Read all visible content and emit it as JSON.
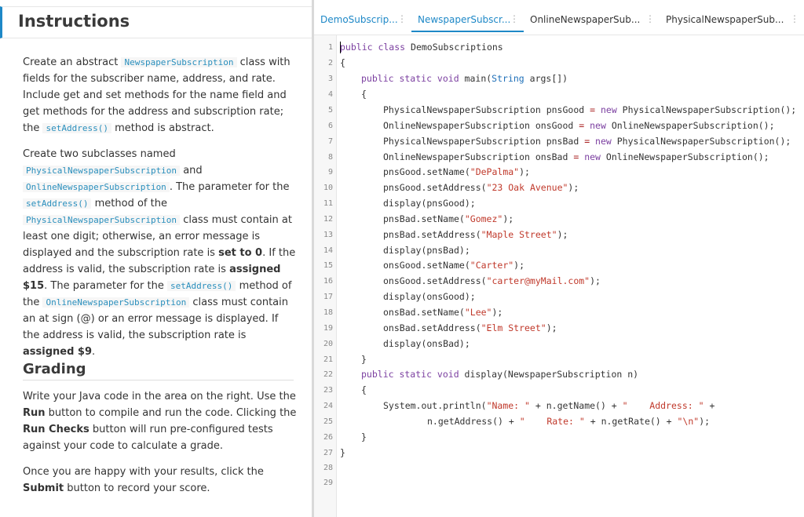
{
  "instructions": {
    "title": "Instructions",
    "p1": {
      "t1": "Create an abstract ",
      "c1": "NewspaperSubscription",
      "t2": " class with fields for the subscriber name, address, and rate. Include get and set methods for the name field and get methods for the address and subscription rate; the ",
      "c2": "setAddress()",
      "t3": " method is abstract."
    },
    "p2": {
      "t1": "Create two subclasses named ",
      "c1": "PhysicalNewspaperSubscription",
      "t2": " and ",
      "c2": "OnlineNewspaperSubscription",
      "t3": ". The parameter for the ",
      "c3": "setAddress()",
      "t4": " method of the ",
      "c4": "PhysicalNewspaperSubscription",
      "t5": " class must contain at least one digit; otherwise, an error message is displayed and the subscription rate is ",
      "b1": "set to 0",
      "t6": ". If the address is valid, the subscription rate is ",
      "b2": "assigned $15",
      "t7": ". The parameter for the ",
      "c5": "setAddress()",
      "t8": " method of the ",
      "c6": "OnlineNewspaperSubscription",
      "t9": " class must contain an at sign (@) or an error message is displayed. If the address is valid, the subscription rate is ",
      "b3": "assigned $9",
      "t10": "."
    }
  },
  "grading": {
    "title": "Grading",
    "p1": {
      "t1": "Write your Java code in the area on the right. Use the ",
      "b1": "Run",
      "t2": " button to compile and run the code. Clicking the ",
      "b2": "Run Checks",
      "t3": " button will run pre-configured tests against your code to calculate a grade."
    },
    "p2": {
      "t1": "Once you are happy with your results, click the ",
      "b1": "Submit",
      "t2": " button to record your score."
    }
  },
  "tabs": [
    {
      "label": "DemoSubscrip..."
    },
    {
      "label": "NewspaperSubscr..."
    },
    {
      "label": "OnlineNewspaperSub..."
    },
    {
      "label": "PhysicalNewspaperSub..."
    }
  ],
  "tab_menu_glyph": "⋮",
  "editor": {
    "line_numbers": [
      "1",
      "2",
      "3",
      "4",
      "5",
      "6",
      "7",
      "8",
      "9",
      "10",
      "11",
      "12",
      "13",
      "14",
      "15",
      "16",
      "17",
      "18",
      "19",
      "20",
      "21",
      "22",
      "23",
      "24",
      "25",
      "26",
      "27",
      "28",
      "29"
    ],
    "code": {
      "l1a": "public class",
      "l1b": " DemoSubscriptions",
      "l2": "{",
      "l3a": "public static void",
      "l3b": " main(",
      "l3c": "String",
      "l3d": " args[])",
      "l4": "{",
      "l5a": "PhysicalNewspaperSubscription pnsGood ",
      "l5b": "=",
      "l5c": " new",
      "l5d": " PhysicalNewspaperSubscription();",
      "l6a": "OnlineNewspaperSubscription onsGood ",
      "l6b": "=",
      "l6c": " new",
      "l6d": " OnlineNewspaperSubscription();",
      "l7a": "PhysicalNewspaperSubscription pnsBad ",
      "l7b": "=",
      "l7c": " new",
      "l7d": " PhysicalNewspaperSubscription();",
      "l8a": "OnlineNewspaperSubscription onsBad ",
      "l8b": "=",
      "l8c": " new",
      "l8d": " OnlineNewspaperSubscription();",
      "l9a": "pnsGood.setName(",
      "l9b": "\"DePalma\"",
      "l9c": ");",
      "l10a": "pnsGood.setAddress(",
      "l10b": "\"23 Oak Avenue\"",
      "l10c": ");",
      "l11": "display(pnsGood);",
      "l12a": "pnsBad.setName(",
      "l12b": "\"Gomez\"",
      "l12c": ");",
      "l13a": "pnsBad.setAddress(",
      "l13b": "\"Maple Street\"",
      "l13c": ");",
      "l14": "display(pnsBad);",
      "l15a": "onsGood.setName(",
      "l15b": "\"Carter\"",
      "l15c": ");",
      "l16a": "onsGood.setAddress(",
      "l16b": "\"carter@myMail.com\"",
      "l16c": ");",
      "l17": "display(onsGood);",
      "l18a": "onsBad.setName(",
      "l18b": "\"Lee\"",
      "l18c": ");",
      "l19a": "onsBad.setAddress(",
      "l19b": "\"Elm Street\"",
      "l19c": ");",
      "l20": "display(onsBad);",
      "l21": "}",
      "l22a": "public static void",
      "l22b": " display(NewspaperSubscription n)",
      "l23": "{",
      "l24a": "System.out.println(",
      "l24b": "\"Name: \"",
      "l24c": " + n.getName() + ",
      "l24d": "\"    Address: \"",
      "l24e": " +",
      "l25a": "n.getAddress() + ",
      "l25b": "\"    Rate: \"",
      "l25c": " + n.getRate() + ",
      "l25d": "\"\\n\"",
      "l25e": ");",
      "l26": "}",
      "l27": "}"
    }
  },
  "colors": {
    "accent": "#1e88c7",
    "keyword": "#7b3fa0",
    "type": "#1e6fb8",
    "string": "#c0392b"
  }
}
